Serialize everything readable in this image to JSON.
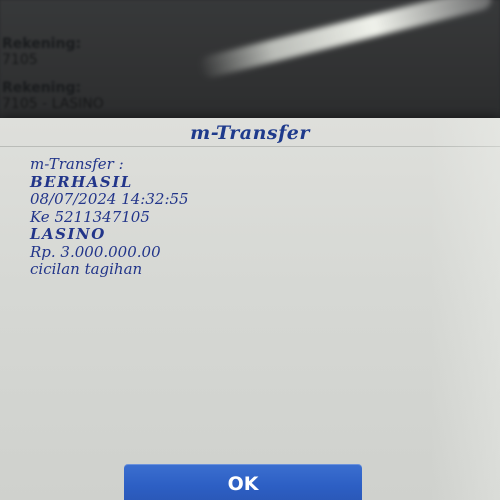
{
  "background_screen": {
    "label_1": "Rekening:",
    "value_1": "7105",
    "label_2": "Rekening:",
    "value_2": "7105 - LASINO"
  },
  "dialog": {
    "title": "m-Transfer",
    "lines": [
      "m-Transfer :",
      "BERHASIL",
      "08/07/2024 14:32:55",
      "Ke 5211347105",
      "LASINO",
      "Rp. 3.000.000.00",
      "cicilan tagihan"
    ],
    "ok_label": "OK"
  },
  "colors": {
    "dialog_text": "#22358a",
    "title": "#1e3a8c",
    "button": "#2d5fc4",
    "dialog_bg": "#d8dad6"
  }
}
